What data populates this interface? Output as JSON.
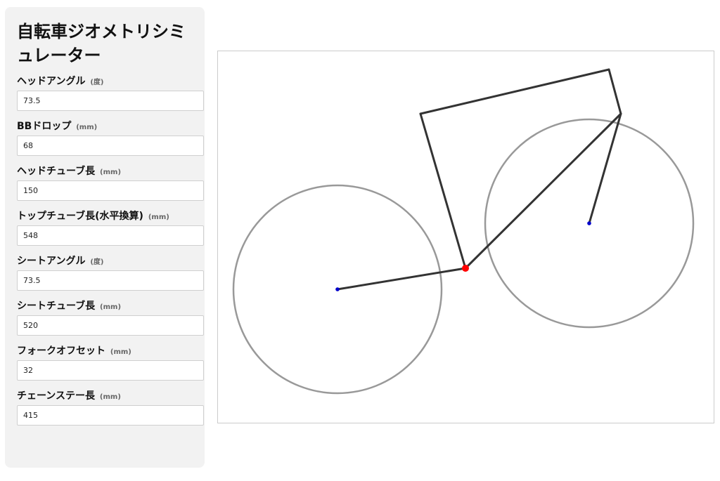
{
  "title": "自転車ジオメトリシミュレーター",
  "fields": [
    {
      "label": "ヘッドアングル",
      "unit": "(度)",
      "value": "73.5"
    },
    {
      "label": "BBドロップ",
      "unit": "(mm)",
      "value": "68"
    },
    {
      "label": "ヘッドチューブ長",
      "unit": "(mm)",
      "value": "150"
    },
    {
      "label": "トップチューブ長(水平換算)",
      "unit": "(mm)",
      "value": "548"
    },
    {
      "label": "シートアングル",
      "unit": "(度)",
      "value": "73.5"
    },
    {
      "label": "シートチューブ長",
      "unit": "(mm)",
      "value": "520"
    },
    {
      "label": "フォークオフセット",
      "unit": "(mm)",
      "value": "32"
    },
    {
      "label": "チェーンステー長",
      "unit": "(mm)",
      "value": "415"
    }
  ],
  "colors": {
    "frame": "#333333",
    "wheel": "#999999",
    "bottom_bracket": "#ff0000",
    "axle": "#0000cc",
    "panel_bg": "#f2f2f2"
  }
}
